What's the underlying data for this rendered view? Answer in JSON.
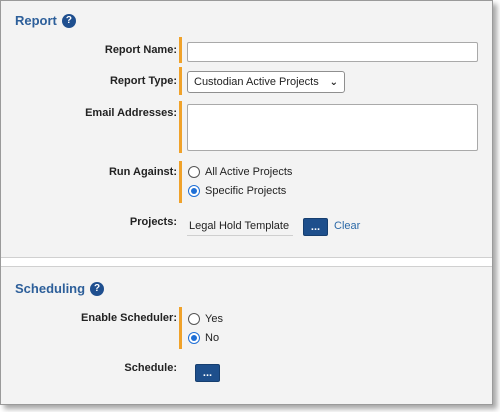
{
  "report": {
    "title": "Report",
    "help_icon": "?",
    "report_name": {
      "label": "Report Name:",
      "value": ""
    },
    "report_type": {
      "label": "Report Type:",
      "value": "Custodian Active Projects"
    },
    "email_addresses": {
      "label": "Email Addresses:",
      "value": ""
    },
    "run_against": {
      "label": "Run Against:",
      "options": [
        "All Active Projects",
        "Specific Projects"
      ],
      "selected": "Specific Projects"
    },
    "projects": {
      "label": "Projects:",
      "value": "Legal Hold Template",
      "browse_label": "...",
      "clear_label": "Clear"
    }
  },
  "scheduling": {
    "title": "Scheduling",
    "help_icon": "?",
    "enable_scheduler": {
      "label": "Enable Scheduler:",
      "options": [
        "Yes",
        "No"
      ],
      "selected": "No"
    },
    "schedule": {
      "label": "Schedule:",
      "browse_label": "..."
    }
  },
  "colors": {
    "accent": "#2d5f9a",
    "required_bar": "#f0a22a",
    "button": "#1e4f8c",
    "radio_checked": "#1f6fd6"
  }
}
